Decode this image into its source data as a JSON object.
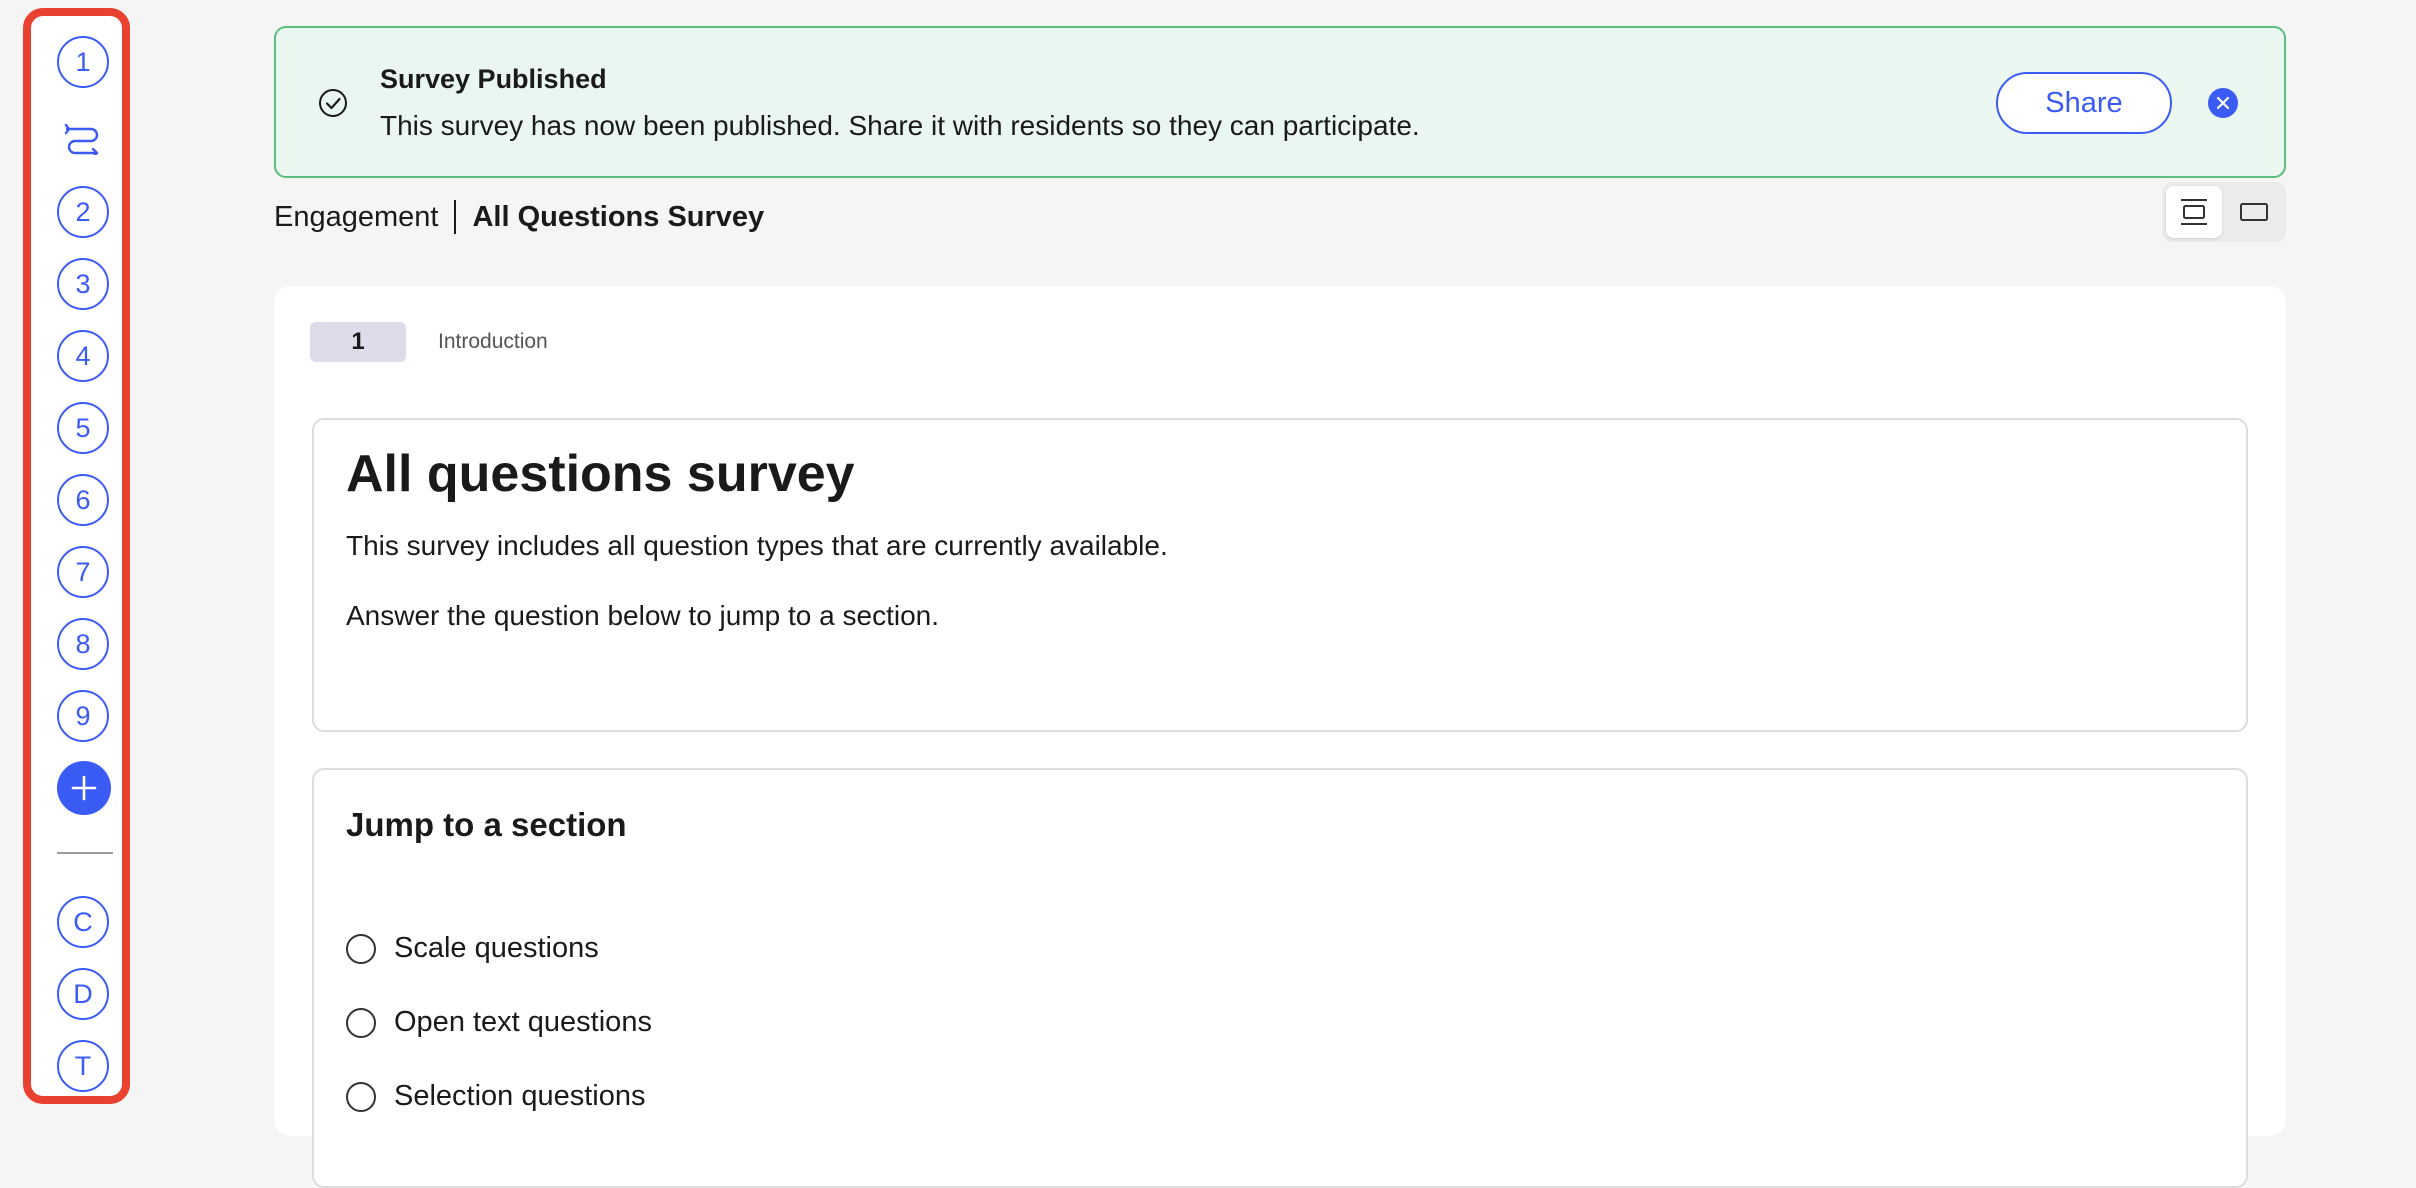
{
  "colors": {
    "accent": "#3b5bf5",
    "rail_highlight": "#e8412f",
    "banner_bg": "#eaf6f0",
    "banner_border": "#5cbf7e"
  },
  "rail": {
    "items": [
      "1",
      "2",
      "3",
      "4",
      "5",
      "6",
      "7",
      "8",
      "9"
    ],
    "logic_icon": "logic-route-icon",
    "add_icon": "plus-icon",
    "bottom_items": [
      "C",
      "D",
      "T"
    ]
  },
  "banner": {
    "icon": "check-circle-icon",
    "title": "Survey Published",
    "message": "This survey has now been published. Share it with residents so they can participate.",
    "share_label": "Share",
    "close_icon": "close-icon"
  },
  "breadcrumb": {
    "parent": "Engagement",
    "current": "All Questions Survey"
  },
  "view_toggle": {
    "options": [
      "page-view-icon",
      "single-view-icon"
    ],
    "active": "page-view-icon"
  },
  "page": {
    "number": "1",
    "label": "Introduction"
  },
  "intro": {
    "title": "All questions survey",
    "paragraph1": "This survey includes all question types that are currently available.",
    "paragraph2": "Answer the question below to jump to a section."
  },
  "jump": {
    "title": "Jump to a section",
    "options": [
      "Scale questions",
      "Open text questions",
      "Selection questions"
    ]
  }
}
